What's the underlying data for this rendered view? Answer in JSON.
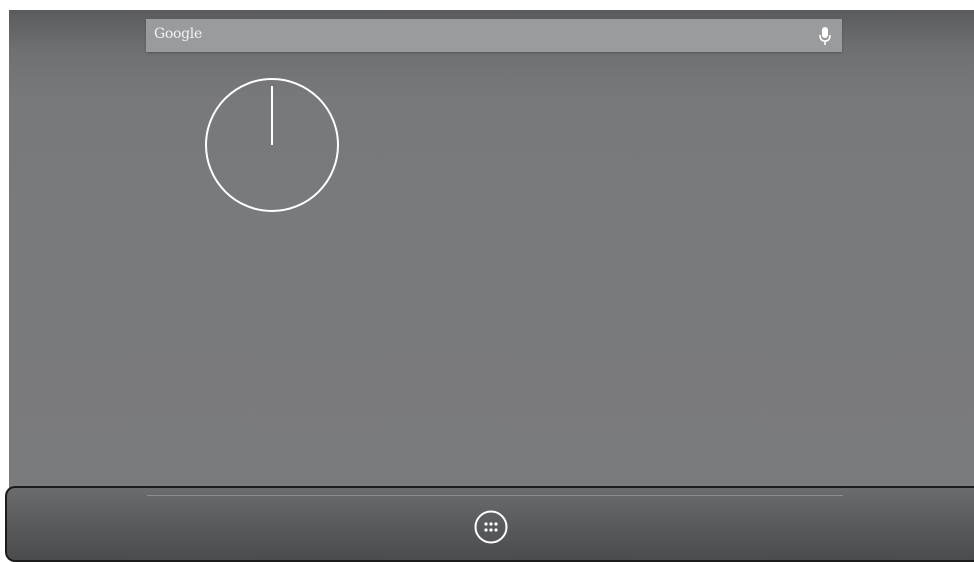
{
  "search": {
    "label": "Google",
    "mic_icon": "microphone-icon"
  },
  "clock": {
    "type": "analog",
    "icon": "analog-clock-icon"
  },
  "dock": {
    "app_drawer_icon": "all-apps-grid-icon"
  },
  "colors": {
    "wallpaper": "#7a7b7d",
    "search_bar": "#9a9b9d",
    "dock": "#58595b",
    "foreground": "#ffffff"
  }
}
